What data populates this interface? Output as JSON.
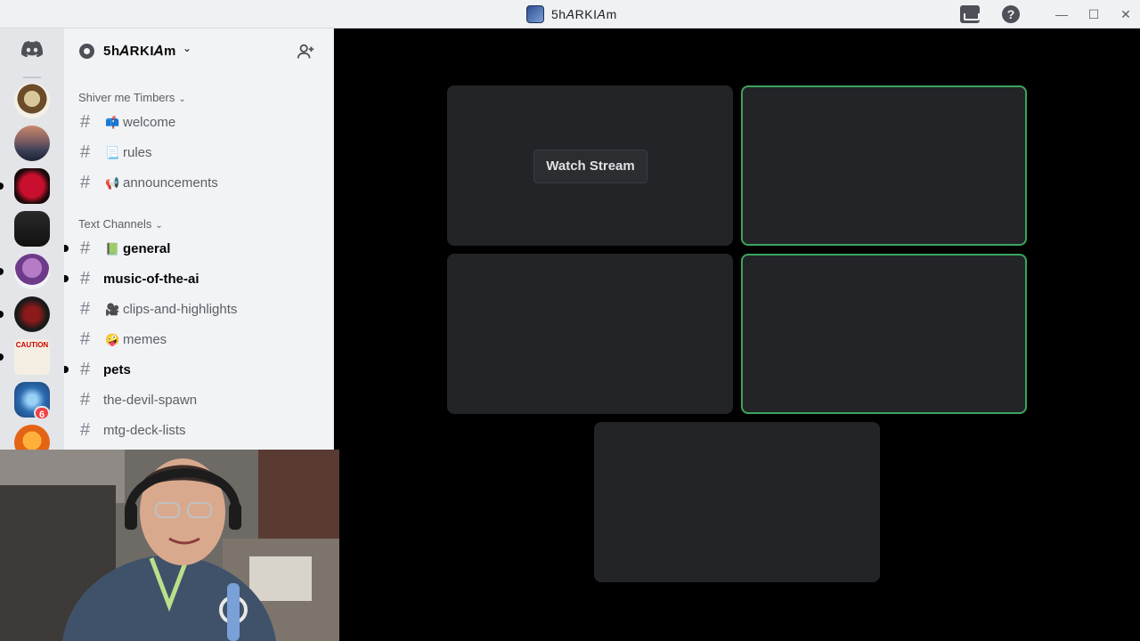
{
  "window": {
    "title": "5h𝘈RKI𝘈m",
    "controls": {
      "minimize": "—",
      "maximize": "☐",
      "close": "✕"
    }
  },
  "server": {
    "name": "5h𝘈RKI𝘈m",
    "chevron": "⌄"
  },
  "categories": [
    {
      "name": "Shiver me Timbers",
      "channels": [
        {
          "label": "welcome",
          "emoji": "📫",
          "unread": false
        },
        {
          "label": "rules",
          "emoji": "📃",
          "unread": false
        },
        {
          "label": "announcements",
          "emoji": "📢",
          "unread": false
        }
      ]
    },
    {
      "name": "Text Channels",
      "channels": [
        {
          "label": "general",
          "emoji": "📗",
          "unread": true
        },
        {
          "label": "music-of-the-ai",
          "emoji": "",
          "unread": true
        },
        {
          "label": "clips-and-highlights",
          "emoji": "🎥",
          "unread": false
        },
        {
          "label": "memes",
          "emoji": "🤪",
          "unread": false
        },
        {
          "label": "pets",
          "emoji": "",
          "unread": true
        },
        {
          "label": "the-devil-spawn",
          "emoji": "",
          "unread": false
        },
        {
          "label": "mtg-deck-lists",
          "emoji": "",
          "unread": false
        }
      ]
    }
  ],
  "rail": {
    "mention_badge": "6",
    "server_image_text": "CAUTION"
  },
  "stage": {
    "watch_stream_label": "Watch Stream"
  },
  "colors": {
    "speaking_border": "#3ba55d",
    "tile_bg": "#232428",
    "badge": "#f23f43"
  },
  "icons": [
    "discord-logo-icon",
    "gear-icon",
    "chevron-down-icon",
    "add-member-icon",
    "hash-icon",
    "inbox-icon",
    "help-icon"
  ]
}
